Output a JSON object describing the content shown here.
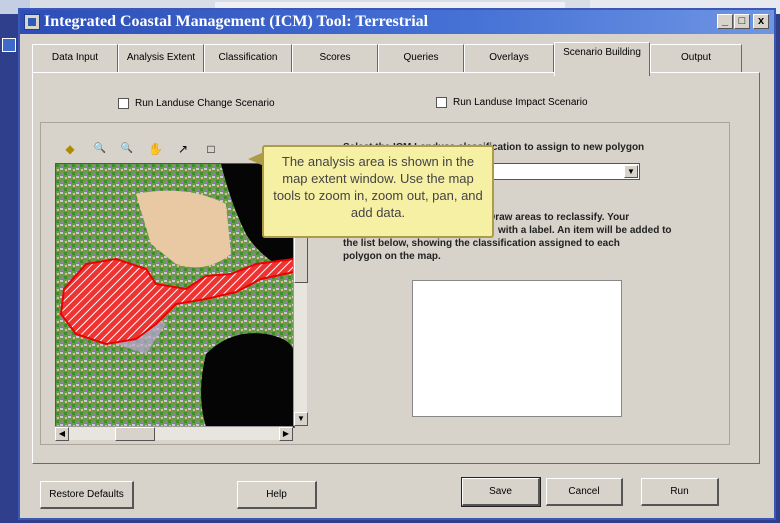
{
  "window": {
    "title": "Integrated Coastal Management (ICM) Tool: Terrestrial",
    "controls": {
      "minimize": "_",
      "maximize": "□",
      "close": "x"
    }
  },
  "tabs": [
    {
      "label": "Data Input"
    },
    {
      "label": "Analysis Extent"
    },
    {
      "label": "Classification"
    },
    {
      "label": "Scores"
    },
    {
      "label": "Queries"
    },
    {
      "label": "Overlays"
    },
    {
      "label": "Scenario Building",
      "active": true
    },
    {
      "label": "Output"
    }
  ],
  "scenario": {
    "run_landuse_change": "Run Landuse Change Scenario",
    "run_landuse_impact": "Run Landuse Impact Scenario"
  },
  "map_tools": [
    {
      "name": "add-data-icon",
      "glyph": "◆"
    },
    {
      "name": "zoom-in-icon",
      "glyph": "🔍"
    },
    {
      "name": "zoom-out-icon",
      "glyph": "🔍"
    },
    {
      "name": "pan-icon",
      "glyph": "✋"
    },
    {
      "name": "identify-icon",
      "glyph": "↗"
    },
    {
      "name": "clear-icon",
      "glyph": "□"
    }
  ],
  "instructions": {
    "select_label": "Select the ICM Landuse classification to assign to new polygon",
    "draw_text_1": "Draw areas to reclassify. Your",
    "draw_text_2": "with a label. An item will be added to",
    "draw_text_3": "the list below, showing the classification assigned to each",
    "draw_text_4": "polygon on the map."
  },
  "tooltip": {
    "text": "The analysis area is shown in the map extent window.  Use the map tools to zoom in, zoom out, pan, and add data."
  },
  "buttons": {
    "restore_defaults": "Restore Defaults",
    "help": "Help",
    "save": "Save",
    "cancel": "Cancel",
    "run": "Run"
  }
}
